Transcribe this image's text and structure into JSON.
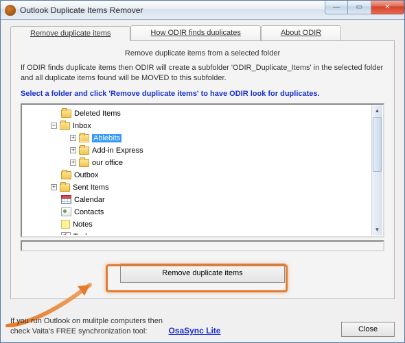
{
  "window": {
    "title": "Outlook Duplicate Items Remover"
  },
  "winbuttons": {
    "min": "—",
    "max": "▭",
    "close": "✕"
  },
  "tabs": [
    {
      "label": "Remove duplicate items",
      "active": true
    },
    {
      "label": "How ODIR finds duplicates",
      "active": false
    },
    {
      "label": "About ODIR",
      "active": false
    }
  ],
  "panel": {
    "heading": "Remove duplicate items from a selected folder",
    "description": "If ODIR finds duplicate items then ODIR will create a subfolder 'ODIR_Duplicate_Items' in the selected folder and all duplicate items found will be MOVED to this subfolder.",
    "instruction": "Select a folder and click 'Remove duplicate items' to have ODIR look for duplicates."
  },
  "tree": [
    {
      "indent": 1,
      "exp": "",
      "icon": "folder",
      "label": "Deleted Items"
    },
    {
      "indent": 1,
      "exp": "-",
      "icon": "folder-open",
      "label": "Inbox"
    },
    {
      "indent": 2,
      "exp": "+",
      "icon": "folder-open",
      "label": "Ablebits",
      "selected": true
    },
    {
      "indent": 2,
      "exp": "+",
      "icon": "folder",
      "label": "Add-in Express"
    },
    {
      "indent": 2,
      "exp": "+",
      "icon": "folder",
      "label": "our office"
    },
    {
      "indent": 1,
      "exp": "",
      "icon": "folder",
      "label": "Outbox"
    },
    {
      "indent": 1,
      "exp": "+",
      "icon": "folder",
      "label": "Sent Items"
    },
    {
      "indent": 1,
      "exp": "",
      "icon": "calendar",
      "label": "Calendar"
    },
    {
      "indent": 1,
      "exp": "",
      "icon": "contacts",
      "label": "Contacts"
    },
    {
      "indent": 1,
      "exp": "",
      "icon": "notes",
      "label": "Notes"
    },
    {
      "indent": 1,
      "exp": "",
      "icon": "tasks",
      "label": "Tasks"
    }
  ],
  "buttons": {
    "main": "Remove duplicate items",
    "close": "Close"
  },
  "promo": {
    "line1": "If you run Outlook on mulitple computers then",
    "line2": "check Vaita's FREE synchronization tool:",
    "link": "OsaSync Lite"
  },
  "colors": {
    "accent": "#e57b2e",
    "link": "#1a2fcf"
  }
}
